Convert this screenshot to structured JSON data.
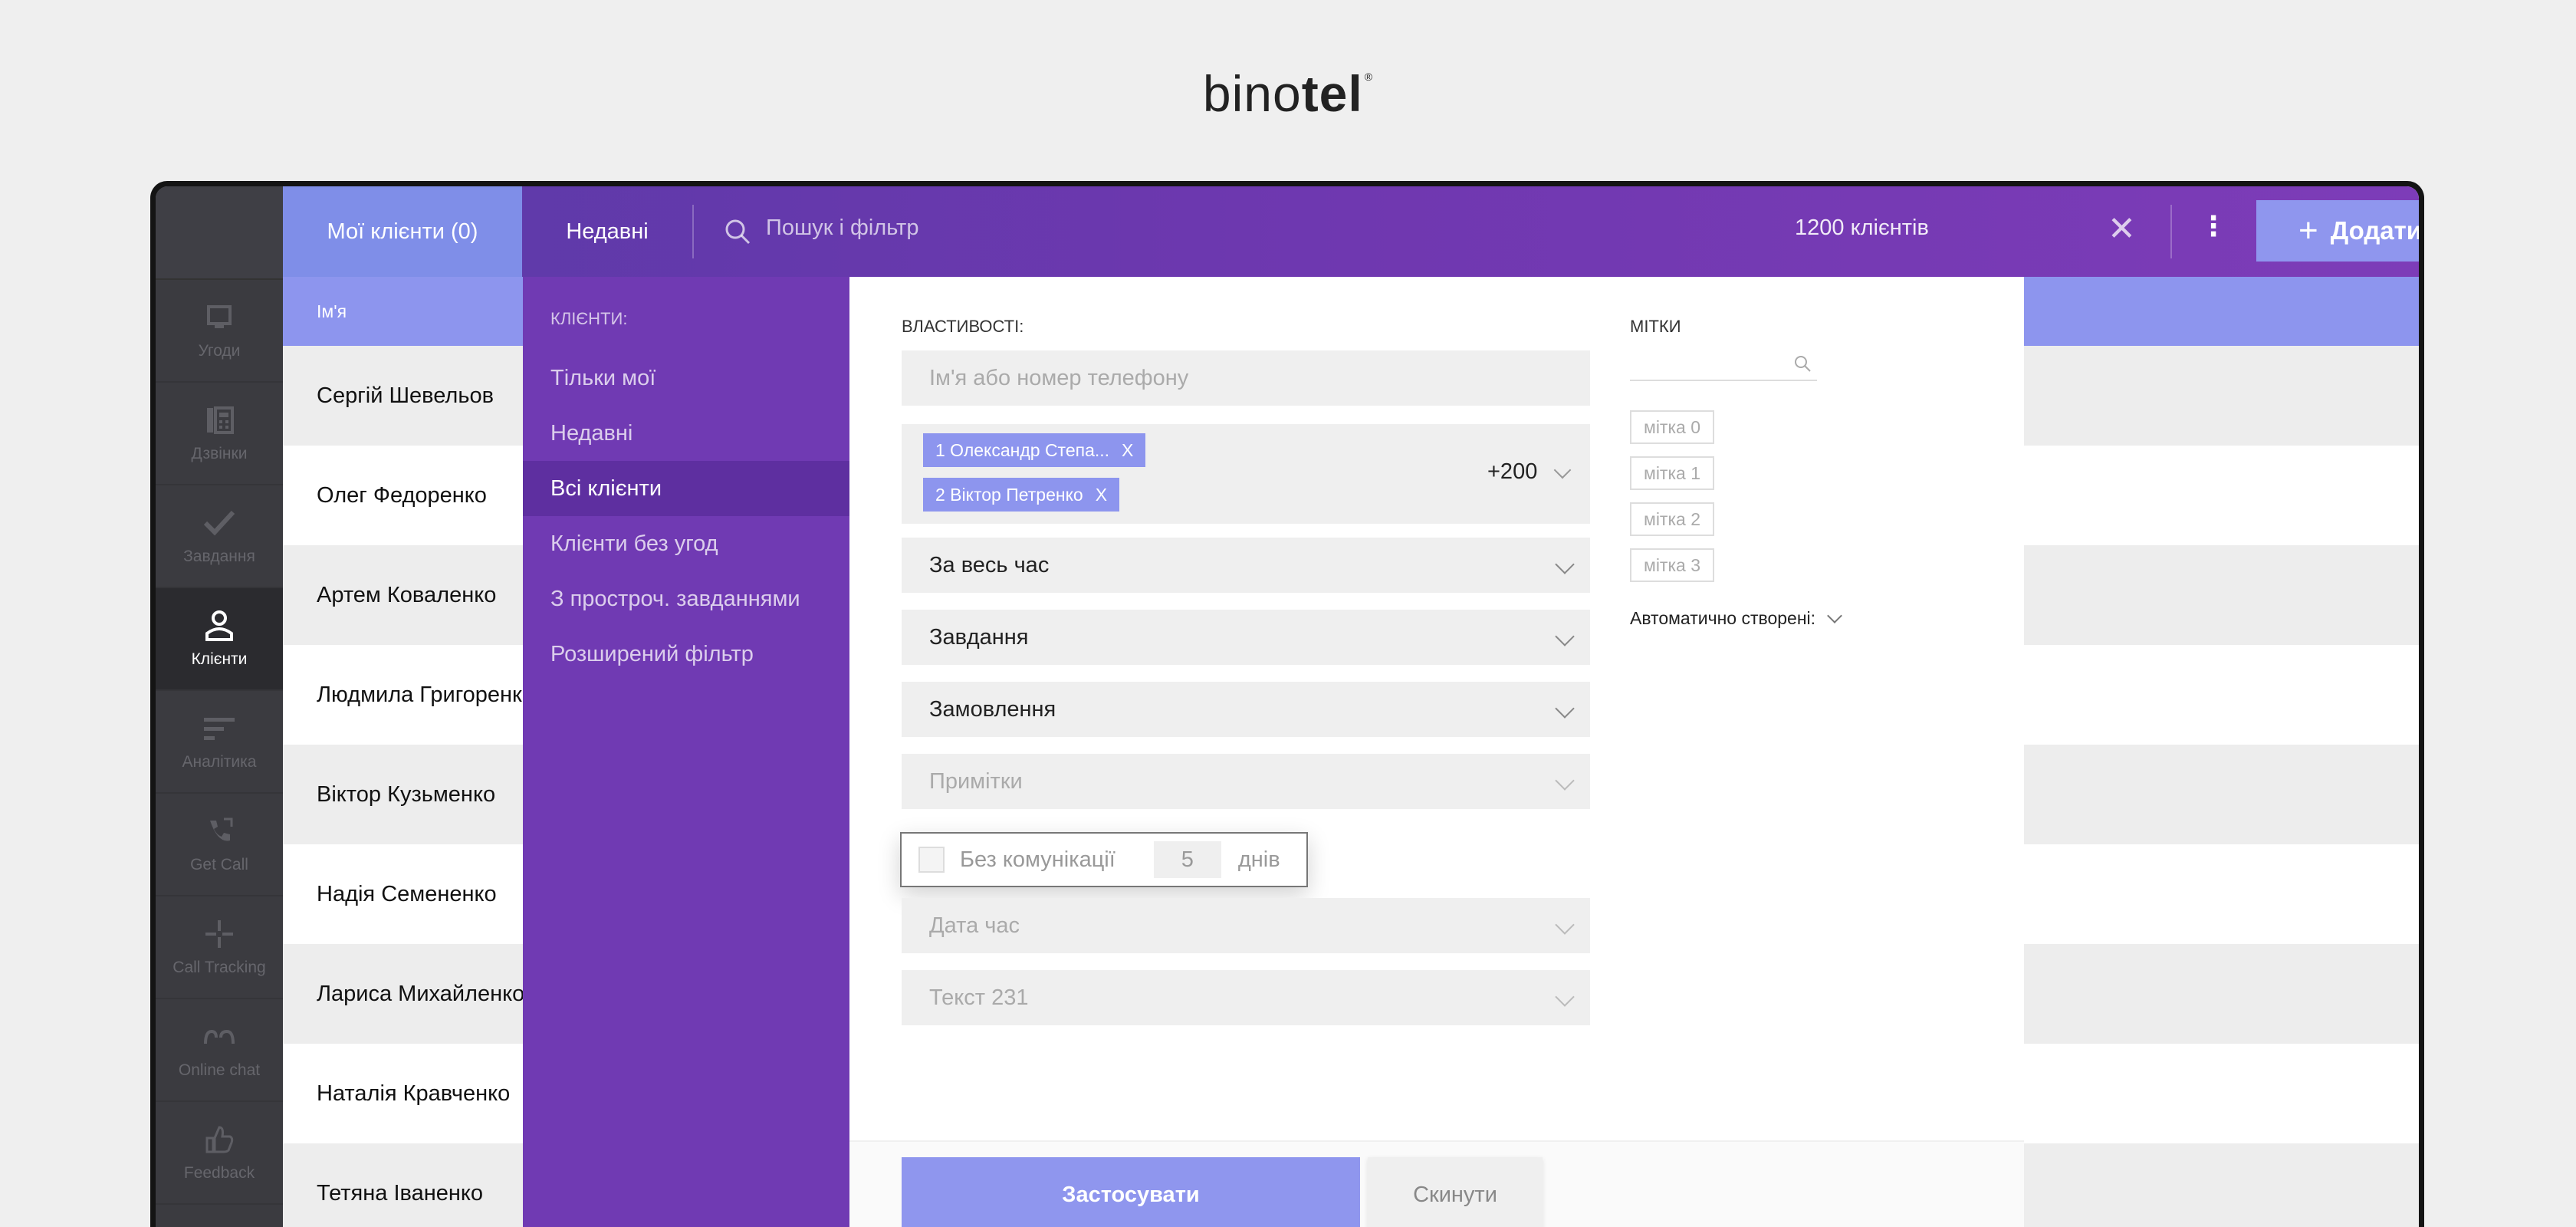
{
  "brand": {
    "logo_light": "bino",
    "logo_bold": "tel",
    "logo_mark": "®"
  },
  "nav": {
    "items": [
      {
        "label": "Угоди",
        "icon": "deals-icon"
      },
      {
        "label": "Дзвінки",
        "icon": "calls-icon"
      },
      {
        "label": "Завдання",
        "icon": "tasks-icon"
      },
      {
        "label": "Клієнти",
        "icon": "clients-icon",
        "active": true
      },
      {
        "label": "Аналітика",
        "icon": "analytics-icon"
      },
      {
        "label": "Get Call",
        "icon": "get-call-icon"
      },
      {
        "label": "Call Tracking",
        "icon": "call-tracking-icon"
      },
      {
        "label": "Online chat",
        "icon": "online-chat-icon"
      },
      {
        "label": "Feedback",
        "icon": "feedback-icon"
      }
    ]
  },
  "topbar": {
    "tab_my": "Мої клієнти (0)",
    "tab_recent": "Недавні",
    "search_placeholder": "Пошук і фільтр",
    "count": "1200 клієнтів",
    "add_label": "Додати клієнта"
  },
  "list": {
    "header": "Ім'я",
    "rows": [
      "Сергій Шевельов",
      "Олег Федоренко",
      "Артем Коваленко",
      "Людмила Григоренко",
      "Віктор Кузьменко",
      "Надія Семененко",
      "Лариса Михайленко",
      "Наталія Кравченко",
      "Тетяна Іваненко"
    ]
  },
  "filters": {
    "title": "Клієнти:",
    "items": [
      {
        "label": "Тільки мої"
      },
      {
        "label": "Недавні"
      },
      {
        "label": "Всі клієнти",
        "active": true
      },
      {
        "label": "Клієнти без угод"
      },
      {
        "label": "З простроч. завданнями"
      },
      {
        "label": "Розширений фільтр"
      }
    ]
  },
  "properties": {
    "title": "ВЛАСТИВОСТІ:",
    "name_placeholder": "Ім'я або номер телефону",
    "chips": [
      "1 Олександр Степа...",
      "2 Віктор Петренко"
    ],
    "chip_close": "X",
    "more_count": "+200",
    "period": "За весь час",
    "tasks": "Завдання",
    "orders": "Замовлення",
    "notes": "Примітки",
    "no_communication": "Без комунікації",
    "days_value": "5",
    "days_label": "днів",
    "datetime": "Дата час",
    "text_field": "Текст 231"
  },
  "marks": {
    "title": "МІТКИ",
    "items": [
      "мітка 0",
      "мітка 1",
      "мітка 2",
      "мітка 3"
    ],
    "auto_created": "Автоматично створені:"
  },
  "actions": {
    "apply": "Застосувати",
    "reset": "Скинути"
  }
}
